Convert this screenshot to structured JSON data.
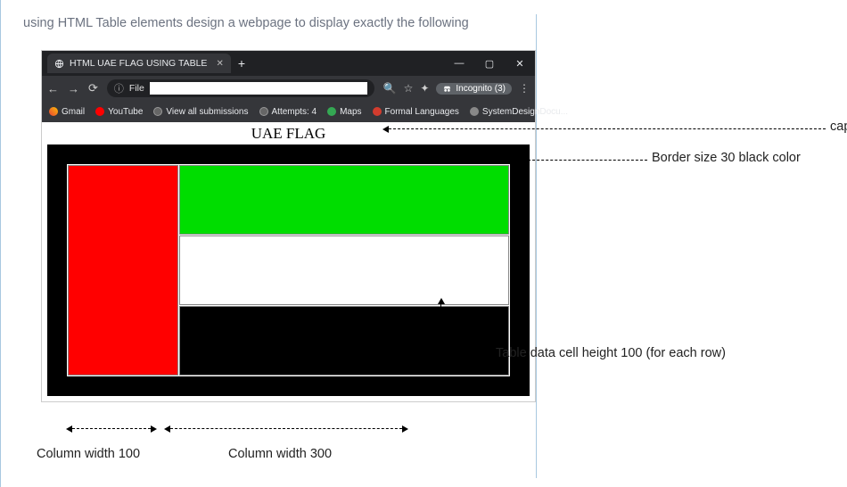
{
  "instruction": "using HTML Table elements design a webpage to display exactly the following",
  "browser": {
    "tab_title": "HTML UAE FLAG USING TABLE",
    "url_prefix": "File",
    "incognito_label": "Incognito (3)",
    "bookmarks": [
      "Gmail",
      "YouTube",
      "View all submissions",
      "Attempts: 4",
      "Maps",
      "Formal Languages",
      "SystemDesignDocu..."
    ]
  },
  "flag": {
    "caption": "UAE FLAG"
  },
  "annotations": {
    "caption": "caption",
    "border": "Border size 30 black color",
    "row_height": "Table data cell height 100 (for each row)",
    "col_left": "Column width 100",
    "col_right": "Column width 300"
  }
}
